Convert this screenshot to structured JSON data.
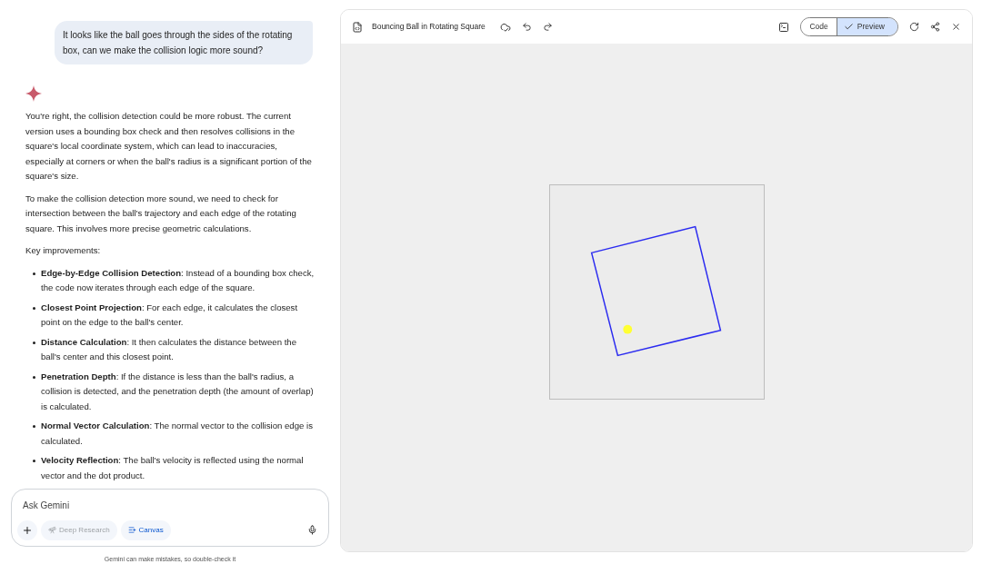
{
  "chat": {
    "user_message": "It looks like the ball goes through the sides of the rotating box, can we make the collision logic more sound?",
    "paragraphs": [
      "You're right, the collision detection could be more robust. The current version uses a bounding box check and then resolves collisions in the square's local coordinate system, which can lead to inaccuracies, especially at corners or when the ball's radius is a significant portion of the square's size.",
      "To make the collision detection more sound, we need to check for intersection between the ball's trajectory and each edge of the rotating square. This involves more precise geometric calculations.",
      "Key improvements:"
    ],
    "bullets": [
      "**Edge-by-Edge Collision Detection**: Instead of a bounding box check, the code now iterates through each edge of the square.",
      "**Closest Point Projection**: For each edge, it calculates the closest point on the edge to the ball's center.",
      "**Distance Calculation**: It then calculates the distance between the ball's center and this closest point.",
      "**Penetration Depth**: If the distance is less than the ball's radius, a collision is detected, and the penetration depth (the amount of overlap) is calculated.",
      "**Normal Vector Calculation**: The normal vector to the collision edge is calculated.",
      "**Velocity Reflection**: The ball's velocity is reflected using the normal vector and the dot product."
    ]
  },
  "input": {
    "placeholder": "Ask Gemini",
    "tools": [
      {
        "label": "Deep Research",
        "disabled": true
      },
      {
        "label": "Canvas",
        "disabled": false
      }
    ]
  },
  "disclaimer": "Gemini can make mistakes, so double-check it",
  "canvas": {
    "title": "Bouncing Ball in Rotating Square",
    "view_toggle": [
      {
        "label": "Code",
        "selected": false
      },
      {
        "label": "Preview",
        "selected": true
      }
    ]
  }
}
